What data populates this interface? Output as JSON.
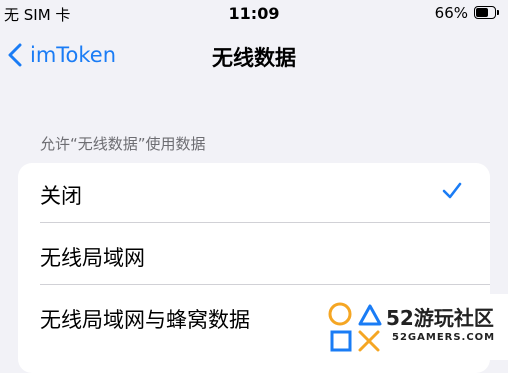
{
  "status_bar": {
    "carrier": "无 SIM 卡",
    "time": "11:09",
    "battery": "66%",
    "battery_level": 0.66
  },
  "nav": {
    "back_label": "imToken",
    "title": "无线数据"
  },
  "section": {
    "header": "允许“无线数据”使用数据",
    "options": [
      {
        "label": "关闭",
        "selected": true
      },
      {
        "label": "无线局域网",
        "selected": false
      },
      {
        "label": "无线局域网与蜂窝数据",
        "selected": false
      }
    ]
  },
  "watermark": {
    "brand": "52游玩社区",
    "sub": "52GAMERS.COM"
  },
  "colors": {
    "accent": "#1a7cf5",
    "background": "#f2f2f7",
    "logo_orange": "#f5a623",
    "logo_blue": "#1a7cf5"
  }
}
